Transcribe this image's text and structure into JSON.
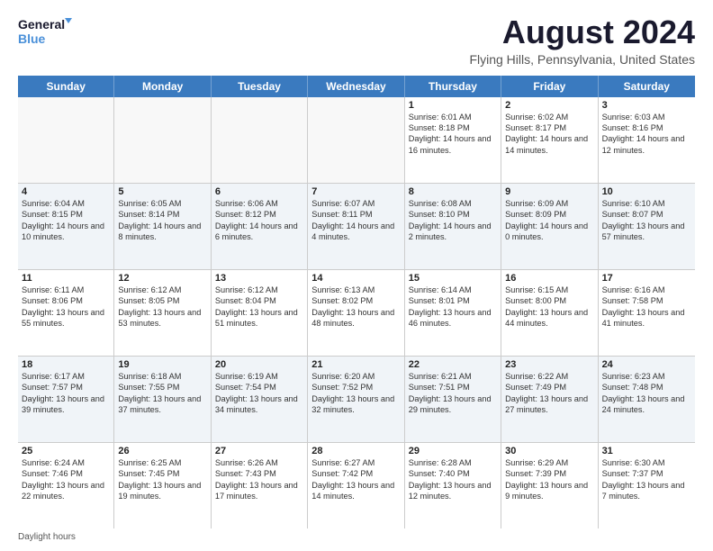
{
  "logo": {
    "line1": "General",
    "line2": "Blue"
  },
  "title": "August 2024",
  "subtitle": "Flying Hills, Pennsylvania, United States",
  "days_header": [
    "Sunday",
    "Monday",
    "Tuesday",
    "Wednesday",
    "Thursday",
    "Friday",
    "Saturday"
  ],
  "weeks": [
    [
      {
        "day": "",
        "info": ""
      },
      {
        "day": "",
        "info": ""
      },
      {
        "day": "",
        "info": ""
      },
      {
        "day": "",
        "info": ""
      },
      {
        "day": "1",
        "info": "Sunrise: 6:01 AM\nSunset: 8:18 PM\nDaylight: 14 hours and 16 minutes."
      },
      {
        "day": "2",
        "info": "Sunrise: 6:02 AM\nSunset: 8:17 PM\nDaylight: 14 hours and 14 minutes."
      },
      {
        "day": "3",
        "info": "Sunrise: 6:03 AM\nSunset: 8:16 PM\nDaylight: 14 hours and 12 minutes."
      }
    ],
    [
      {
        "day": "4",
        "info": "Sunrise: 6:04 AM\nSunset: 8:15 PM\nDaylight: 14 hours and 10 minutes."
      },
      {
        "day": "5",
        "info": "Sunrise: 6:05 AM\nSunset: 8:14 PM\nDaylight: 14 hours and 8 minutes."
      },
      {
        "day": "6",
        "info": "Sunrise: 6:06 AM\nSunset: 8:12 PM\nDaylight: 14 hours and 6 minutes."
      },
      {
        "day": "7",
        "info": "Sunrise: 6:07 AM\nSunset: 8:11 PM\nDaylight: 14 hours and 4 minutes."
      },
      {
        "day": "8",
        "info": "Sunrise: 6:08 AM\nSunset: 8:10 PM\nDaylight: 14 hours and 2 minutes."
      },
      {
        "day": "9",
        "info": "Sunrise: 6:09 AM\nSunset: 8:09 PM\nDaylight: 14 hours and 0 minutes."
      },
      {
        "day": "10",
        "info": "Sunrise: 6:10 AM\nSunset: 8:07 PM\nDaylight: 13 hours and 57 minutes."
      }
    ],
    [
      {
        "day": "11",
        "info": "Sunrise: 6:11 AM\nSunset: 8:06 PM\nDaylight: 13 hours and 55 minutes."
      },
      {
        "day": "12",
        "info": "Sunrise: 6:12 AM\nSunset: 8:05 PM\nDaylight: 13 hours and 53 minutes."
      },
      {
        "day": "13",
        "info": "Sunrise: 6:12 AM\nSunset: 8:04 PM\nDaylight: 13 hours and 51 minutes."
      },
      {
        "day": "14",
        "info": "Sunrise: 6:13 AM\nSunset: 8:02 PM\nDaylight: 13 hours and 48 minutes."
      },
      {
        "day": "15",
        "info": "Sunrise: 6:14 AM\nSunset: 8:01 PM\nDaylight: 13 hours and 46 minutes."
      },
      {
        "day": "16",
        "info": "Sunrise: 6:15 AM\nSunset: 8:00 PM\nDaylight: 13 hours and 44 minutes."
      },
      {
        "day": "17",
        "info": "Sunrise: 6:16 AM\nSunset: 7:58 PM\nDaylight: 13 hours and 41 minutes."
      }
    ],
    [
      {
        "day": "18",
        "info": "Sunrise: 6:17 AM\nSunset: 7:57 PM\nDaylight: 13 hours and 39 minutes."
      },
      {
        "day": "19",
        "info": "Sunrise: 6:18 AM\nSunset: 7:55 PM\nDaylight: 13 hours and 37 minutes."
      },
      {
        "day": "20",
        "info": "Sunrise: 6:19 AM\nSunset: 7:54 PM\nDaylight: 13 hours and 34 minutes."
      },
      {
        "day": "21",
        "info": "Sunrise: 6:20 AM\nSunset: 7:52 PM\nDaylight: 13 hours and 32 minutes."
      },
      {
        "day": "22",
        "info": "Sunrise: 6:21 AM\nSunset: 7:51 PM\nDaylight: 13 hours and 29 minutes."
      },
      {
        "day": "23",
        "info": "Sunrise: 6:22 AM\nSunset: 7:49 PM\nDaylight: 13 hours and 27 minutes."
      },
      {
        "day": "24",
        "info": "Sunrise: 6:23 AM\nSunset: 7:48 PM\nDaylight: 13 hours and 24 minutes."
      }
    ],
    [
      {
        "day": "25",
        "info": "Sunrise: 6:24 AM\nSunset: 7:46 PM\nDaylight: 13 hours and 22 minutes."
      },
      {
        "day": "26",
        "info": "Sunrise: 6:25 AM\nSunset: 7:45 PM\nDaylight: 13 hours and 19 minutes."
      },
      {
        "day": "27",
        "info": "Sunrise: 6:26 AM\nSunset: 7:43 PM\nDaylight: 13 hours and 17 minutes."
      },
      {
        "day": "28",
        "info": "Sunrise: 6:27 AM\nSunset: 7:42 PM\nDaylight: 13 hours and 14 minutes."
      },
      {
        "day": "29",
        "info": "Sunrise: 6:28 AM\nSunset: 7:40 PM\nDaylight: 13 hours and 12 minutes."
      },
      {
        "day": "30",
        "info": "Sunrise: 6:29 AM\nSunset: 7:39 PM\nDaylight: 13 hours and 9 minutes."
      },
      {
        "day": "31",
        "info": "Sunrise: 6:30 AM\nSunset: 7:37 PM\nDaylight: 13 hours and 7 minutes."
      }
    ]
  ],
  "footer": {
    "daylight_label": "Daylight hours"
  }
}
